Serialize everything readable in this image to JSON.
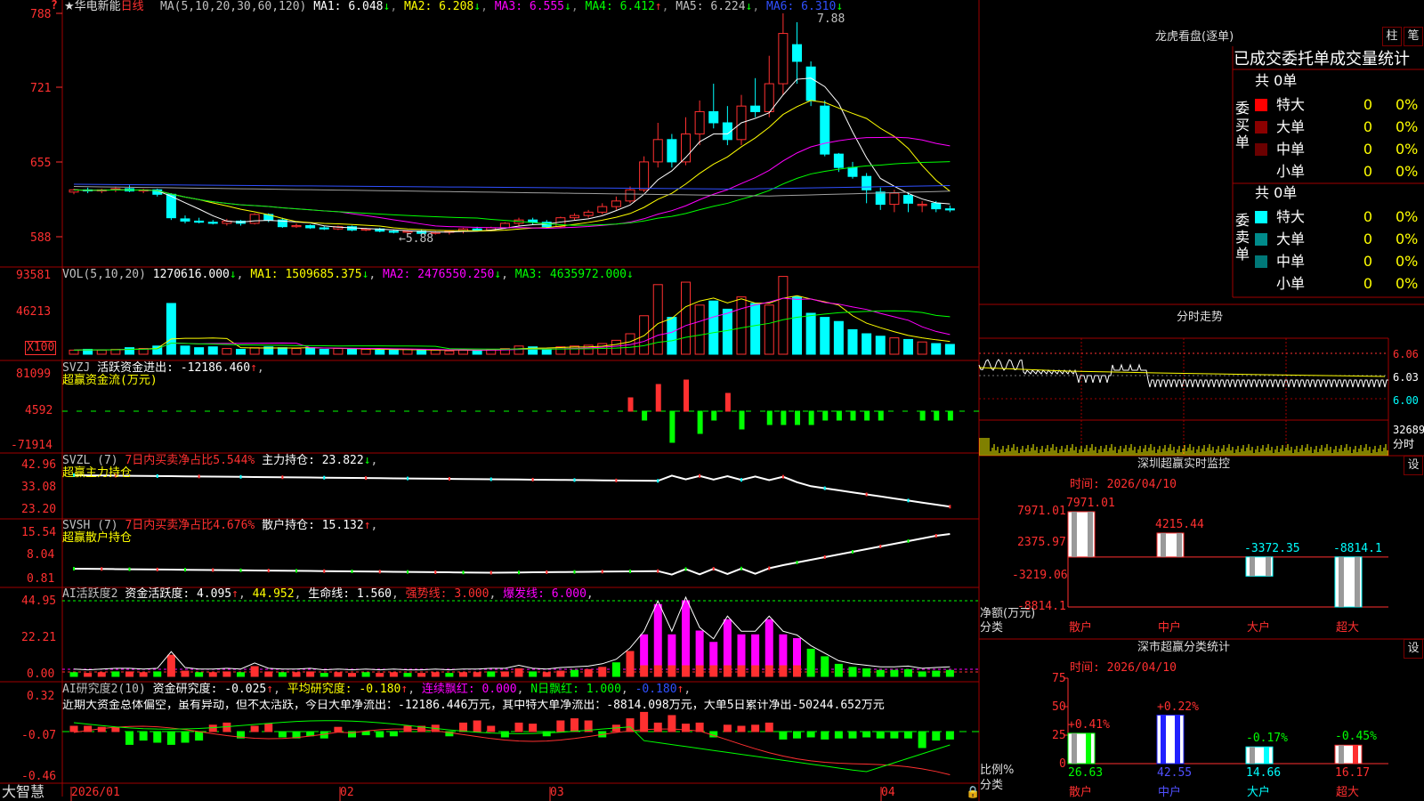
{
  "app": {
    "brand": "大智慧"
  },
  "stock": {
    "name": "华电新能",
    "period": "日线",
    "star_icon": "star-icon",
    "help_icon": "question-icon"
  },
  "indicators": {
    "main": {
      "title": "MA(5,10,20,30,60,120)",
      "ma1": "MA1: 6.048",
      "ma2": "MA2: 6.208",
      "ma3": "MA3: 6.555",
      "ma4": "MA4: 6.412",
      "ma5": "MA5: 6.224",
      "ma6": "MA6: 6.310",
      "high_label": "7.88",
      "low_label": "←5.88",
      "axis": [
        "788",
        "721",
        "655",
        "588"
      ]
    },
    "vol": {
      "title": "VOL(5,10,20)",
      "value": "1270616.000",
      "ma1": "MA1: 1509685.375",
      "ma2": "MA2: 2476550.250",
      "ma3": "MA3: 4635972.000",
      "axis": [
        "93581",
        "46213"
      ],
      "unit": "X100"
    },
    "svzj": {
      "title": "SVZJ",
      "label": "活跃资金进出: -12186.460",
      "sub": "超赢资金流(万元)",
      "axis": [
        "81099",
        "4592",
        "-71914"
      ]
    },
    "svzl": {
      "title": "SVZL (7)",
      "ratio": "7日内买卖净占比5.544%",
      "hold": "主力持仓: 23.822",
      "sub": "超赢主力持仓",
      "axis": [
        "42.96",
        "33.08",
        "23.20"
      ]
    },
    "svsh": {
      "title": "SVSH (7)",
      "ratio": "7日内买卖净占比4.676%",
      "hold": "散户持仓: 15.132",
      "sub": "超赢散户持仓",
      "axis": [
        "15.54",
        "8.04",
        "0.81"
      ]
    },
    "ai_active": {
      "title": "AI活跃度2",
      "label": "资金活跃度: 4.095",
      "v2": "44.952",
      "life": "生命线: 1.560",
      "strong": "强势线: 3.000",
      "burst": "爆发线: 6.000",
      "axis": [
        "44.95",
        "22.21",
        "0.00"
      ]
    },
    "ai_research": {
      "title": "AI研究度2(10)",
      "label": "资金研究度: -0.025",
      "avg": "平均研究度: -0.180",
      "red": "连续飘红: 0.000",
      "nred": "N日飘红: 1.000",
      "last": "-0.180",
      "axis": [
        "0.32",
        "-0.07",
        "-0.46"
      ],
      "summary": "近期大资金总体偏空，虽有异动，但不太活跃，今日大单净流出：-12186.446万元，其中特大单净流出：-8814.098万元，大单5日累计净出-50244.652万元"
    }
  },
  "xaxis": {
    "labels": [
      "2026/01",
      "02",
      "03",
      "04"
    ]
  },
  "dragon": {
    "title": "龙虎看盘(逐单)",
    "tab1": "柱",
    "tab2": "笔",
    "header": "已成交委托单成交量统计",
    "buy": {
      "side": "委买单",
      "total": "共 0单",
      "rows": [
        {
          "label": "特大",
          "count": "0",
          "pct": "0%",
          "color": "#ff0000"
        },
        {
          "label": "大单",
          "count": "0",
          "pct": "0%",
          "color": "#8b0000"
        },
        {
          "label": "中单",
          "count": "0",
          "pct": "0%",
          "color": "#6b0000"
        },
        {
          "label": "小单",
          "count": "0",
          "pct": "0%",
          "color": ""
        }
      ]
    },
    "sell": {
      "side": "委卖单",
      "total": "共 0单",
      "rows": [
        {
          "label": "特大",
          "count": "0",
          "pct": "0%",
          "color": "#00ffff"
        },
        {
          "label": "大单",
          "count": "0",
          "pct": "0%",
          "color": "#008b8b"
        },
        {
          "label": "中单",
          "count": "0",
          "pct": "0%",
          "color": "#007878"
        },
        {
          "label": "小单",
          "count": "0",
          "pct": "0%",
          "color": ""
        }
      ]
    }
  },
  "intraday": {
    "title": "分时走势",
    "axis": [
      "6.06",
      "6.03",
      "6.00"
    ],
    "vol_label": "32689",
    "unit": "分时"
  },
  "sz_monitor": {
    "title": "深圳超赢实时监控",
    "set": "设",
    "time": "时间: 2026/04/10",
    "axis": [
      "7971.01",
      "2375.97",
      "-3219.06",
      "-8814.1"
    ],
    "ylabel": "净额(万元)",
    "xlabel": "分类",
    "chart_data": {
      "type": "bar",
      "categories": [
        "散户",
        "中户",
        "大户",
        "超大"
      ],
      "values": [
        7971.01,
        4215.44,
        -3372.35,
        -8814.1
      ],
      "value_labels": [
        "7971.01",
        "4215.44",
        "-3372.35",
        "-8814.1"
      ],
      "ylim": [
        -8814.1,
        7971.01
      ]
    }
  },
  "sz_class": {
    "title": "深市超赢分类统计",
    "set": "设",
    "time": "时间: 2026/04/10",
    "axis": [
      "75",
      "50",
      "25",
      "0"
    ],
    "ylabel": "比例%",
    "xlabel": "分类",
    "chart_data": {
      "type": "bar",
      "categories": [
        "散户",
        "中户",
        "大户",
        "超大"
      ],
      "values": [
        26.63,
        42.55,
        14.66,
        16.17
      ],
      "change_labels": [
        "+0.41%",
        "+0.22%",
        "-0.17%",
        "-0.45%"
      ],
      "value_labels": [
        "26.63",
        "42.55",
        "14.66",
        "16.17"
      ],
      "ylim": [
        0,
        75
      ]
    }
  }
}
